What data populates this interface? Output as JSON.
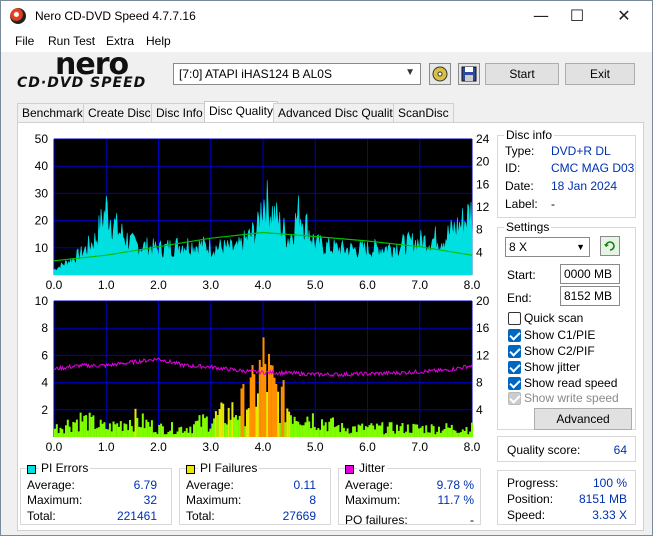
{
  "window": {
    "title": "Nero CD-DVD Speed 4.7.7.16",
    "minimize": "—",
    "maximize": "☐",
    "close": "✕"
  },
  "menu": [
    "File",
    "Run Test",
    "Extra",
    "Help"
  ],
  "logo": {
    "brand": "nero",
    "product": "CD·DVD SPEED"
  },
  "toolbar": {
    "drive": "[7:0]  ATAPI iHAS124   B AL0S",
    "start_label": "Start",
    "exit_label": "Exit"
  },
  "tabs": [
    "Benchmark",
    "Create Disc",
    "Disc Info",
    "Disc Quality",
    "Advanced Disc Quality",
    "ScanDisc"
  ],
  "active_tab": "Disc Quality",
  "disc_info": {
    "title": "Disc info",
    "type_label": "Type:",
    "type": "DVD+R DL",
    "id_label": "ID:",
    "id": "CMC MAG D03",
    "date_label": "Date:",
    "date": "18 Jan 2024",
    "label_label": "Label:",
    "label": "-"
  },
  "settings": {
    "title": "Settings",
    "speed": "8 X",
    "start_label": "Start:",
    "start": "0000 MB",
    "end_label": "End:",
    "end": "8152 MB",
    "quick_scan": "Quick scan",
    "show_c1pie": "Show C1/PIE",
    "show_c2pif": "Show C2/PIF",
    "show_jitter": "Show jitter",
    "show_read_speed": "Show read speed",
    "show_write_speed": "Show write speed",
    "advanced_label": "Advanced"
  },
  "quality": {
    "label": "Quality score:",
    "value": "64"
  },
  "progress": {
    "progress_label": "Progress:",
    "progress": "100 %",
    "position_label": "Position:",
    "position": "8151 MB",
    "speed_label": "Speed:",
    "speed": "3.33 X"
  },
  "pi_errors": {
    "title": "PI Errors",
    "avg_label": "Average:",
    "avg": "6.79",
    "max_label": "Maximum:",
    "max": "32",
    "total_label": "Total:",
    "total": "221461"
  },
  "pi_failures": {
    "title": "PI Failures",
    "avg_label": "Average:",
    "avg": "0.11",
    "max_label": "Maximum:",
    "max": "8",
    "total_label": "Total:",
    "total": "27669"
  },
  "jitter": {
    "title": "Jitter",
    "avg_label": "Average:",
    "avg": "9.78 %",
    "max_label": "Maximum:",
    "max": "11.7 %",
    "po_label": "PO failures:",
    "po": "-"
  },
  "colors": {
    "pie": "#00e0e0",
    "pif": "#e8e800",
    "jitter": "#e000e0",
    "read_speed": "#00c000",
    "pif_low": "#80ff00",
    "grid": "#0000c0"
  },
  "chart_data": [
    {
      "type": "area",
      "x_ticks": [
        "0.0",
        "1.0",
        "2.0",
        "3.0",
        "4.0",
        "5.0",
        "6.0",
        "7.0",
        "8.0"
      ],
      "y_left_ticks": [
        "50",
        "40",
        "30",
        "20",
        "10"
      ],
      "y_right_ticks": [
        "24",
        "20",
        "16",
        "12",
        "8",
        "4"
      ],
      "xlim": [
        0,
        8
      ],
      "ylim_left": [
        0,
        50
      ],
      "ylim_right": [
        0,
        24
      ],
      "series": [
        {
          "x": [
            0,
            0.5,
            0.8,
            1.0,
            1.2,
            1.5,
            2.0,
            2.5,
            3.0,
            3.5,
            3.9,
            4.0,
            4.5,
            4.7,
            5.0,
            5.5,
            6.0,
            6.5,
            7.0,
            7.5,
            7.8,
            8.0
          ],
          "y": [
            2,
            8,
            14,
            26,
            18,
            12,
            10,
            12,
            11,
            10,
            18,
            30,
            14,
            25,
            12,
            10,
            10,
            11,
            13,
            15,
            20,
            25
          ]
        },
        {
          "x": [
            0,
            1,
            2,
            3,
            4,
            5,
            6,
            7,
            8
          ],
          "y": [
            2.5,
            3.5,
            5,
            6.5,
            7.5,
            6.8,
            6,
            5,
            3.5
          ]
        }
      ]
    },
    {
      "type": "bar",
      "x_ticks": [
        "0.0",
        "1.0",
        "2.0",
        "3.0",
        "4.0",
        "5.0",
        "6.0",
        "7.0",
        "8.0"
      ],
      "y_left_ticks": [
        "10",
        "8",
        "6",
        "4",
        "2"
      ],
      "y_right_ticks": [
        "20",
        "16",
        "12",
        "8",
        "4"
      ],
      "xlim": [
        0,
        8
      ],
      "ylim_left": [
        0,
        10
      ],
      "ylim_right": [
        0,
        20
      ],
      "series": [
        {
          "x": [
            0,
            0.5,
            1.0,
            1.5,
            2.0,
            2.5,
            3.0,
            3.5,
            3.8,
            4.0,
            4.2,
            4.5,
            5.0,
            5.5,
            6.0,
            6.5,
            7.0,
            7.5,
            8.0
          ],
          "y": [
            1,
            2,
            1,
            2,
            1,
            1,
            2,
            3,
            5,
            8,
            5,
            3,
            2,
            1,
            1,
            1,
            1,
            1,
            1
          ]
        },
        {
          "x": [
            0,
            0.5,
            1.0,
            1.5,
            2.0,
            2.5,
            3.0,
            3.5,
            4.0,
            4.5,
            5.0,
            5.5,
            6.0,
            6.5,
            7.0,
            7.5,
            8.0
          ],
          "y": [
            10,
            10.5,
            10.5,
            11,
            11.5,
            10.5,
            10.3,
            9.8,
            9.5,
            9.4,
            9.2,
            9.2,
            9.3,
            9.4,
            9.6,
            9.8,
            10.5
          ]
        }
      ]
    }
  ]
}
